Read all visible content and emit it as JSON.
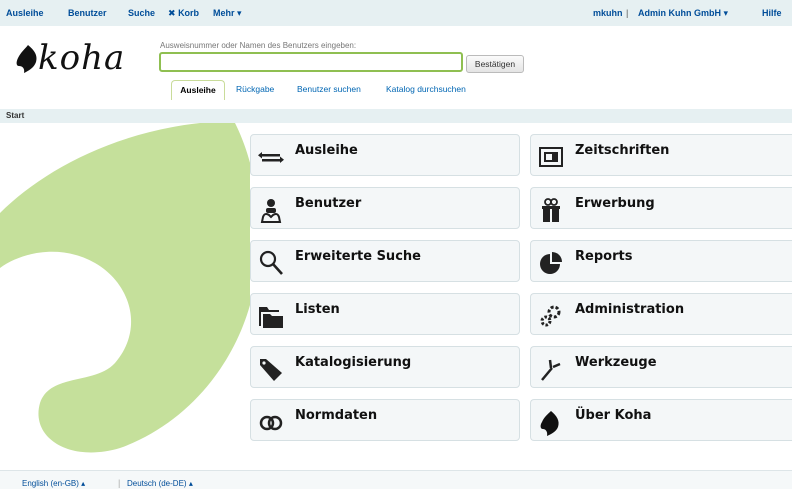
{
  "topnav": {
    "circulation": "Ausleihe",
    "patrons": "Benutzer",
    "search": "Suche",
    "cart": "Korb",
    "more": "Mehr",
    "user": "mkuhn",
    "branch": "Admin Kuhn GmbH",
    "help": "Hilfe"
  },
  "header": {
    "logo_text": "koha",
    "search_hint": "Ausweisnummer oder Namen des Benutzers eingeben:",
    "search_value": "",
    "submit_label": "Bestätigen",
    "tabs": [
      "Ausleihe",
      "Rückgabe",
      "Benutzer suchen",
      "Katalog durchsuchen"
    ]
  },
  "breadcrumb": "Start",
  "modules": [
    {
      "label": "Ausleihe",
      "icon": "circulation-icon"
    },
    {
      "label": "Zeitschriften",
      "icon": "serials-icon"
    },
    {
      "label": "Benutzer",
      "icon": "patrons-icon"
    },
    {
      "label": "Erwerbung",
      "icon": "acquisitions-icon"
    },
    {
      "label": "Erweiterte Suche",
      "icon": "search-icon"
    },
    {
      "label": "Reports",
      "icon": "reports-icon"
    },
    {
      "label": "Listen",
      "icon": "lists-icon"
    },
    {
      "label": "Administration",
      "icon": "administration-icon"
    },
    {
      "label": "Katalogisierung",
      "icon": "cataloging-icon"
    },
    {
      "label": "Werkzeuge",
      "icon": "tools-icon"
    },
    {
      "label": "Normdaten",
      "icon": "authorities-icon"
    },
    {
      "label": "Über Koha",
      "icon": "koha-icon"
    }
  ],
  "footer": {
    "lang_en": "English (en-GB)",
    "lang_de": "Deutsch (de-DE)"
  },
  "colors": {
    "nav_link": "#004d99",
    "accent_green": "#8fbf51",
    "curl_green": "#c5e09b"
  }
}
